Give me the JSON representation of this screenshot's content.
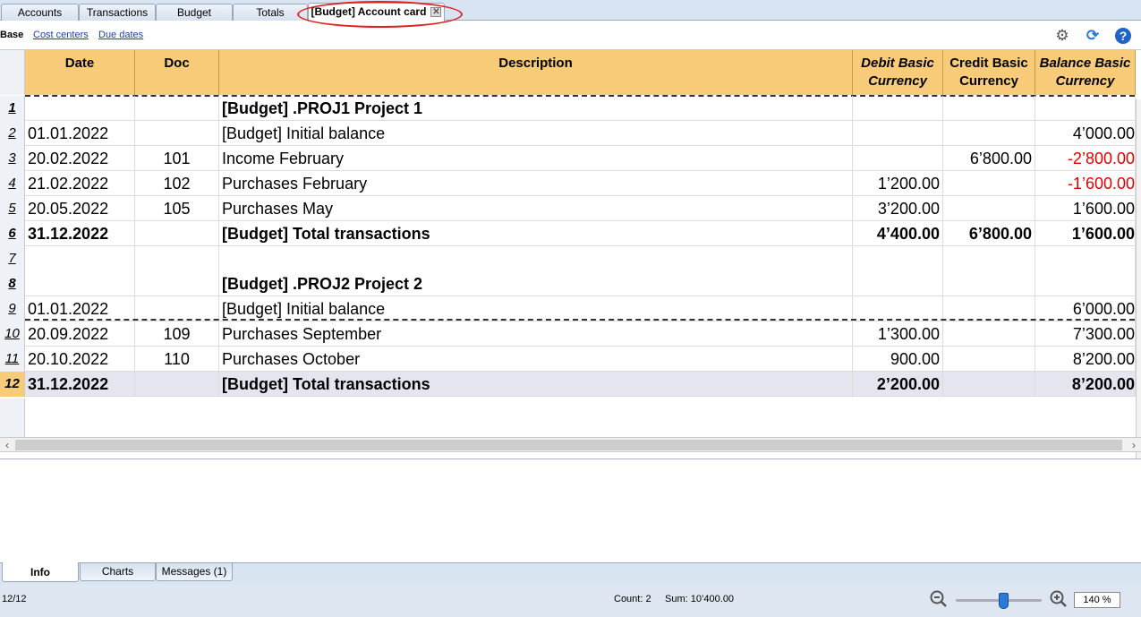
{
  "tabs": [
    {
      "label": "Accounts"
    },
    {
      "label": "Transactions"
    },
    {
      "label": "Budget"
    },
    {
      "label": "Totals"
    },
    {
      "label": "[Budget] Account card",
      "active": true
    }
  ],
  "subnav": {
    "base": "Base",
    "cost_centers": "Cost centers",
    "due_dates": "Due dates"
  },
  "toolbar_icons": [
    "gear-icon",
    "refresh-icon",
    "help-icon"
  ],
  "columns": {
    "date": "Date",
    "doc": "Doc",
    "description": "Description",
    "debit_1": "Debit Basic",
    "debit_2": "Currency",
    "credit_1": "Credit Basic",
    "credit_2": "Currency",
    "balance_1": "Balance Basic",
    "balance_2": "Currency"
  },
  "rows": [
    {
      "n": "1",
      "date": "",
      "doc": "",
      "desc": "[Budget] .PROJ1 Project 1",
      "debit": "",
      "credit": "",
      "balance": ""
    },
    {
      "n": "2",
      "date": "01.01.2022",
      "doc": "",
      "desc": "[Budget] Initial balance",
      "debit": "",
      "credit": "",
      "balance": "4’000.00"
    },
    {
      "n": "3",
      "date": "20.02.2022",
      "doc": "101",
      "desc": "Income February",
      "debit": "",
      "credit": "6’800.00",
      "balance": "-2’800.00"
    },
    {
      "n": "4",
      "date": "21.02.2022",
      "doc": "102",
      "desc": "Purchases February",
      "debit": "1’200.00",
      "credit": "",
      "balance": "-1’600.00"
    },
    {
      "n": "5",
      "date": "20.05.2022",
      "doc": "105",
      "desc": "Purchases May",
      "debit": "3’200.00",
      "credit": "",
      "balance": "1’600.00"
    },
    {
      "n": "6",
      "date": "31.12.2022",
      "doc": "",
      "desc": "[Budget] Total transactions",
      "debit": "4’400.00",
      "credit": "6’800.00",
      "balance": "1’600.00"
    },
    {
      "n": "7",
      "date": "",
      "doc": "",
      "desc": "",
      "debit": "",
      "credit": "",
      "balance": ""
    },
    {
      "n": "8",
      "date": "",
      "doc": "",
      "desc": "[Budget] .PROJ2 Project 2",
      "debit": "",
      "credit": "",
      "balance": ""
    },
    {
      "n": "9",
      "date": "01.01.2022",
      "doc": "",
      "desc": "[Budget] Initial balance",
      "debit": "",
      "credit": "",
      "balance": "6’000.00"
    },
    {
      "n": "10",
      "date": "20.09.2022",
      "doc": "109",
      "desc": "Purchases September",
      "debit": "1’300.00",
      "credit": "",
      "balance": "7’300.00"
    },
    {
      "n": "11",
      "date": "20.10.2022",
      "doc": "110",
      "desc": "Purchases October",
      "debit": "900.00",
      "credit": "",
      "balance": "8’200.00"
    },
    {
      "n": "12",
      "date": "31.12.2022",
      "doc": "",
      "desc": "[Budget] Total transactions",
      "debit": "2’200.00",
      "credit": "",
      "balance": "8’200.00"
    }
  ],
  "bottom_tabs": [
    {
      "label": "Info",
      "active": true
    },
    {
      "label": "Charts"
    },
    {
      "label": "Messages (1)"
    }
  ],
  "status": {
    "position": "12/12",
    "count": "Count: 2",
    "sum": "Sum: 10’400.00",
    "zoom": "140 %"
  },
  "colors": {
    "header": "#f8cb78",
    "negative": "#e00000",
    "selection": "#e4e5ef",
    "annotation": "#d22222"
  }
}
